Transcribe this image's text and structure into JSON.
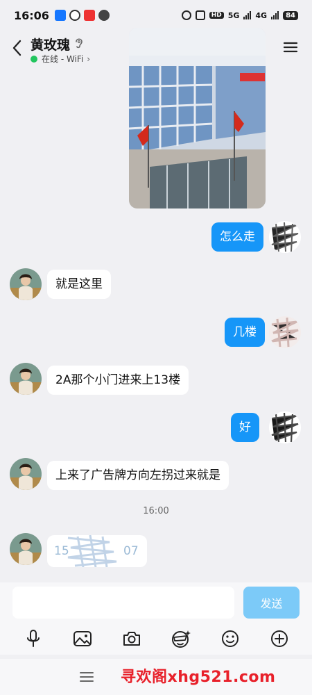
{
  "status_bar": {
    "time": "16:06",
    "hd": "HD",
    "net_5g": "5G",
    "net_4g": "4G",
    "battery": "84"
  },
  "header": {
    "contact_name": "黄玫瑰",
    "status": "在线 - WiFi",
    "status_chevron": "›"
  },
  "messages": [
    {
      "side": "out",
      "type": "image"
    },
    {
      "side": "out",
      "text": "怎么走"
    },
    {
      "side": "in",
      "text": "就是这里"
    },
    {
      "side": "out",
      "text": "几楼"
    },
    {
      "side": "in",
      "text": "2A那个小门进来上13楼"
    },
    {
      "side": "out",
      "text": "好"
    },
    {
      "side": "in",
      "text": "上来了广告牌方向左拐过来就是"
    },
    {
      "side": "in",
      "text": "15",
      "text_end": "07",
      "redacted": true
    }
  ],
  "time_separator": "16:00",
  "composer": {
    "placeholder": "",
    "send_label": "发送"
  },
  "toolbar_icons": [
    "microphone-icon",
    "image-icon",
    "camera-icon",
    "sticker-icon",
    "emoji-icon",
    "plus-icon"
  ],
  "watermark": "寻欢阁xhg521.com",
  "colors": {
    "bubble_out": "#1696f8",
    "bubble_in": "#ffffff",
    "background": "#f0f0f3",
    "send_button": "#7ccaf8",
    "online_dot": "#22c55e",
    "watermark": "#e8202a"
  }
}
